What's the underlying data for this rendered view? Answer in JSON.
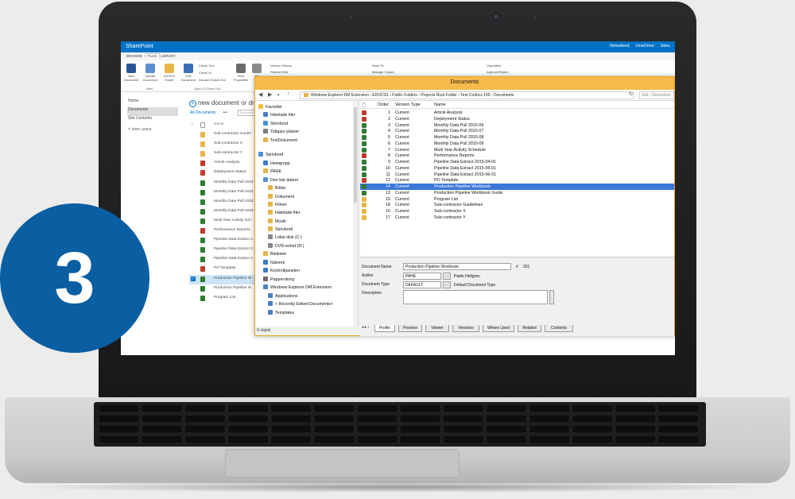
{
  "badge": {
    "number": "3"
  },
  "sharepoint": {
    "title": "SharePoint",
    "top_links": [
      "Newsfeed",
      "OneDrive",
      "Sites"
    ],
    "ribbon_tabs": [
      "BROWSE",
      "FILES",
      "LIBRARY"
    ],
    "ribbon_buttons": [
      "New Document",
      "Upload Document",
      "eDOCS Folder",
      "Edit Document",
      "View Properties",
      "Pr"
    ],
    "ribbon_small": [
      "Check Out",
      "Check In",
      "Discard Check Out",
      "Version History",
      "Shared With",
      "Send To",
      "Manage Copies",
      "Unpublish",
      "Approve/Reject"
    ],
    "ribbon_groups": [
      "New",
      "Open & Check Out"
    ],
    "left_nav": [
      "Home",
      "Documents",
      "Site Contents"
    ],
    "edit_links": "EDIT LINKS",
    "new_document": "new document or dra",
    "all_documents": "All Documents",
    "ellipsis": "•••",
    "find_file": "Find a file",
    "name_header": "Name",
    "list": [
      "Sub-contractor Guidel",
      "Sub-contractor X",
      "Sub-contractor Y",
      "Article Analysis",
      "Deployment Status",
      "Monthly Data Pull 2015",
      "Monthly Data Pull 2015",
      "Monthly Data Pull 2015",
      "Monthly Data Pull 2015",
      "Multi Year Activity Sch",
      "Performance Reports",
      "Pipeline Data Extract 2",
      "Pipeline Data Extract 2",
      "Pipeline Data Extract 2",
      "PO Template",
      "Production Pipeline W",
      "Production Pipeline W",
      "Program List"
    ]
  },
  "dm_window": {
    "title": "Documents",
    "path": "Windows Explorer DM Extension  ›  EDOCS1  ›  Public Folders  ›  Projects Root Folder  ›  Test Codocs 100  ›  Documents",
    "search_placeholder": "Sök i Skärmdum",
    "tree": [
      "Favoriter",
      "Hämtade filer",
      "Skrivbord",
      "Tidigare platser",
      "TestDokument",
      "Skrivbord",
      "Hemgrupp",
      "PAHE",
      "Den här datorn",
      "Bilder",
      "Dokument",
      "Filmer",
      "Hämtade filer",
      "Musik",
      "Skrivbord",
      "Lokal disk (C:)",
      "DVD-enhet (D:)",
      "Bibliotek",
      "Nätverk",
      "Kontrollpanelen",
      "Papperskorg",
      "Windows Explorer DM Extension",
      "Applications",
      "< Recently Edited Documents>",
      "Templates"
    ],
    "status": "9 objekt",
    "columns": [
      "Order",
      "Version Type",
      "Name"
    ],
    "rows": [
      {
        "order": "1",
        "version": "Current",
        "name": "Article Analysis"
      },
      {
        "order": "2",
        "version": "Current",
        "name": "Deployment Status"
      },
      {
        "order": "3",
        "version": "Current",
        "name": "Monthly Data Pull 2015-06"
      },
      {
        "order": "4",
        "version": "Current",
        "name": "Monthly Data Pull 2015-07"
      },
      {
        "order": "5",
        "version": "Current",
        "name": "Monthly Data Pull 2015-08"
      },
      {
        "order": "6",
        "version": "Current",
        "name": "Monthly Data Pull 2015-09"
      },
      {
        "order": "7",
        "version": "Current",
        "name": "Multi Year Activity Schedule"
      },
      {
        "order": "8",
        "version": "Current",
        "name": "Performance Reports"
      },
      {
        "order": "9",
        "version": "Current",
        "name": "Pipeline Data Extract 2015-04-01"
      },
      {
        "order": "10",
        "version": "Current",
        "name": "Pipeline Data Extract 2015-05-01"
      },
      {
        "order": "11",
        "version": "Current",
        "name": "Pipeline Data Extract 2015-06-01"
      },
      {
        "order": "12",
        "version": "Current",
        "name": "PO Template"
      },
      {
        "order": "14",
        "version": "Current",
        "name": "Production Pipeline Workbook"
      },
      {
        "order": "13",
        "version": "Current",
        "name": "Production Pipeline Workbook Guide"
      },
      {
        "order": "15",
        "version": "Current",
        "name": "Program List"
      },
      {
        "order": "18",
        "version": "Current",
        "name": "Sub-contractor Guidelines"
      },
      {
        "order": "16",
        "version": "Current",
        "name": "Sub-contractor X"
      },
      {
        "order": "17",
        "version": "Current",
        "name": "Sub-contractor Y"
      }
    ],
    "selected_index": 12,
    "profile": {
      "document_name_label": "Document Name",
      "document_name": "Production Pipeline Workbook",
      "number_sign": "#",
      "number": "201",
      "author_label": "Author",
      "author": "PAHE",
      "author_full": "Patrik Hellgren",
      "doc_type_label": "Document Type",
      "doc_type": "DEFAULT",
      "doc_type_full": "Default Document Type",
      "description_label": "Description",
      "browse": "..."
    },
    "tabs": [
      "Profile",
      "Preview",
      "Viewer",
      "Versions",
      "Where Used",
      "Related",
      "Contents"
    ]
  },
  "colors": {
    "sharepoint_blue": "#0072c6",
    "dm_title": "#f6b94a",
    "selection": "#3b78d8",
    "badge": "#0a5fa3"
  }
}
